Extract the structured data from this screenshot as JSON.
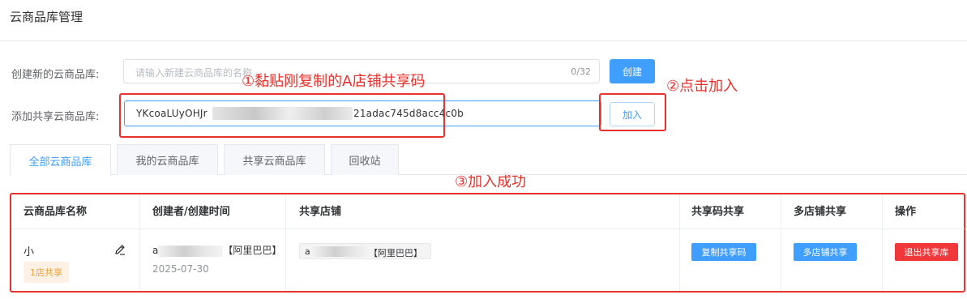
{
  "page": {
    "title": "云商品库管理"
  },
  "form": {
    "create_label": "创建新的云商品库:",
    "create_placeholder": "请输入新建云商品库的名称",
    "create_counter": "0/32",
    "create_button": "创建",
    "share_label": "添加共享云商品库:",
    "share_value_start": "YKcoaLUyOHJr",
    "share_value_end": "21adac745d8acc4c0b",
    "join_button": "加入"
  },
  "annotations": {
    "step1": "①黏贴刚复制的A店铺共享码",
    "step2": "②点击加入",
    "step3": "③加入成功"
  },
  "tabs": [
    {
      "label": "全部云商品库",
      "active": true
    },
    {
      "label": "我的云商品库",
      "active": false
    },
    {
      "label": "共享云商品库",
      "active": false
    },
    {
      "label": "回收站",
      "active": false
    }
  ],
  "table": {
    "headers": [
      "云商品库名称",
      "创建者/创建时间",
      "共享店铺",
      "共享码共享",
      "多店铺共享",
      "操作"
    ],
    "row": {
      "name": "小",
      "badge": "1店共享",
      "creator_prefix": "a",
      "creator_suffix": "【阿里巴巴】",
      "created_date": "2025-07-30",
      "shop_prefix": "a",
      "shop_suffix": "【阿里巴巴】",
      "copy_code_button": "复制共享码",
      "multi_shop_button": "多店铺共享",
      "exit_button": "退出共享库"
    }
  },
  "colors": {
    "primary": "#409eff",
    "annotation_red": "#e9322d",
    "exit_red": "#f0383b",
    "badge_orange": "#e6a23c"
  },
  "icons": {
    "edit": "pencil-edit-icon"
  }
}
